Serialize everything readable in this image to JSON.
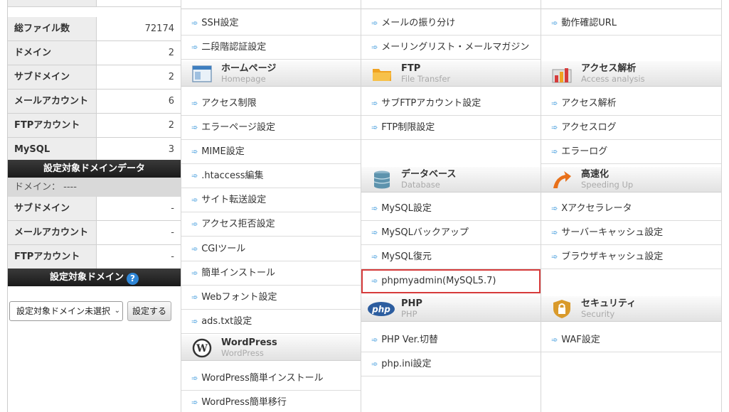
{
  "stats": [
    {
      "label": "総ファイル数",
      "value": "72174"
    },
    {
      "label": "ドメイン",
      "value": "2"
    },
    {
      "label": "サブドメイン",
      "value": "2"
    },
    {
      "label": "メールアカウント",
      "value": "6"
    },
    {
      "label": "FTPアカウント",
      "value": "2"
    },
    {
      "label": "MySQL",
      "value": "3"
    }
  ],
  "target_domain_data": {
    "header": "設定対象ドメインデータ",
    "domain_line": "ドメイン： ----",
    "rows": [
      {
        "label": "サブドメイン",
        "value": "-"
      },
      {
        "label": "メールアカウント",
        "value": "-"
      },
      {
        "label": "FTPアカウント",
        "value": "-"
      }
    ]
  },
  "target_domain": {
    "header": "設定対象ドメイン",
    "help_icon": "?",
    "select_value": "設定対象ドメイン未選択",
    "select_chevron": "⌄",
    "button_label": "設定する"
  },
  "arrow_glyph": "➾",
  "col1": {
    "top_items": [
      "SSH設定",
      "二段階認証設定"
    ],
    "homepage": {
      "title": "ホームページ",
      "subtitle": "Homepage",
      "icon": "window-icon"
    },
    "homepage_items": [
      "アクセス制限",
      "エラーページ設定",
      "MIME設定",
      ".htaccess編集",
      "サイト転送設定",
      "アクセス拒否設定",
      "CGIツール",
      "簡単インストール",
      "Webフォント設定",
      "ads.txt設定"
    ],
    "wordpress": {
      "title": "WordPress",
      "subtitle": "WordPress",
      "icon": "wordpress-icon"
    },
    "wordpress_items": [
      "WordPress簡単インストール",
      "WordPress簡単移行"
    ]
  },
  "col2": {
    "top_items": [
      "メールの振り分け",
      "メーリングリスト・メールマガジン"
    ],
    "ftp": {
      "title": "FTP",
      "subtitle": "File Transfer",
      "icon": "folder-icon"
    },
    "ftp_items": [
      "サブFTPアカウント設定",
      "FTP制限設定"
    ],
    "database": {
      "title": "データベース",
      "subtitle": "Database",
      "icon": "database-icon"
    },
    "database_items": [
      "MySQL設定",
      "MySQLバックアップ",
      "MySQL復元",
      "phpmyadmin(MySQL5.7)"
    ],
    "php": {
      "title": "PHP",
      "subtitle": "PHP",
      "icon_text": "php",
      "icon": "php-icon"
    },
    "php_items": [
      "PHP Ver.切替",
      "php.ini設定"
    ]
  },
  "col3": {
    "top_items": [
      "動作確認URL"
    ],
    "access": {
      "title": "アクセス解析",
      "subtitle": "Access analysis",
      "icon": "bar-chart-icon"
    },
    "access_items": [
      "アクセス解析",
      "アクセスログ",
      "エラーログ"
    ],
    "speed": {
      "title": "高速化",
      "subtitle": "Speeding Up",
      "icon": "speed-arrow-icon"
    },
    "speed_items": [
      "Xアクセラレータ",
      "サーバーキャッシュ設定",
      "ブラウザキャッシュ設定"
    ],
    "security": {
      "title": "セキュリティ",
      "subtitle": "Security",
      "icon": "padlock-icon"
    },
    "security_items": [
      "WAF設定"
    ]
  },
  "colors": {
    "accent": "#2a8fd8",
    "highlight_border": "#d63b3b",
    "header_dark": "#222222"
  }
}
